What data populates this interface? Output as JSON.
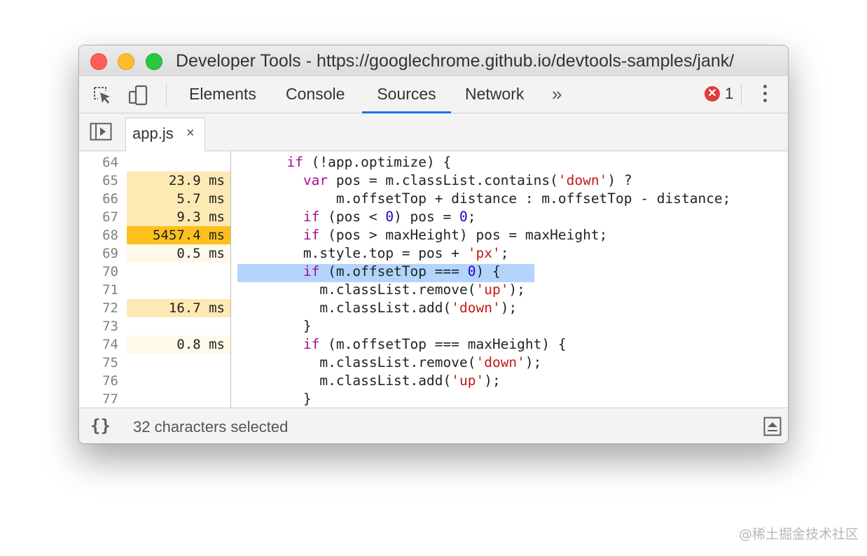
{
  "window": {
    "title": "Developer Tools - https://googlechrome.github.io/devtools-samples/jank/"
  },
  "toolbar": {
    "inspect_icon": "inspect-element-icon",
    "device_icon": "device-toolbar-icon",
    "tabs": [
      {
        "label": "Elements",
        "active": false
      },
      {
        "label": "Console",
        "active": false
      },
      {
        "label": "Sources",
        "active": true
      },
      {
        "label": "Network",
        "active": false
      }
    ],
    "more_tabs": "»",
    "error_count": "1",
    "active_tab_color": "#1a73e8",
    "error_color": "#e03c3c"
  },
  "file_tabs": [
    {
      "name": "app.js",
      "close": "×"
    }
  ],
  "editor": {
    "lines": [
      {
        "num": "64",
        "timing": "",
        "heat": "none"
      },
      {
        "num": "65",
        "timing": "23.9 ms",
        "heat": "light"
      },
      {
        "num": "66",
        "timing": "5.7 ms",
        "heat": "light"
      },
      {
        "num": "67",
        "timing": "9.3 ms",
        "heat": "light"
      },
      {
        "num": "68",
        "timing": "5457.4 ms",
        "heat": "hot"
      },
      {
        "num": "69",
        "timing": "0.5 ms",
        "heat": "faint"
      },
      {
        "num": "70",
        "timing": "",
        "heat": "none"
      },
      {
        "num": "71",
        "timing": "",
        "heat": "none"
      },
      {
        "num": "72",
        "timing": "16.7 ms",
        "heat": "light"
      },
      {
        "num": "73",
        "timing": "",
        "heat": "none"
      },
      {
        "num": "74",
        "timing": "0.8 ms",
        "heat": "faint"
      },
      {
        "num": "75",
        "timing": "",
        "heat": "none"
      },
      {
        "num": "76",
        "timing": "",
        "heat": "none"
      },
      {
        "num": "77",
        "timing": "",
        "heat": "none"
      }
    ],
    "heat_colors": {
      "hot": "#fdc01c",
      "light": "#fde9b3",
      "faint": "#fef9e8",
      "none": "transparent"
    },
    "selection_color": "#b3d4fd",
    "selected_line": "70"
  },
  "statusbar": {
    "pretty_print": "{}",
    "selection_text": "32 characters selected"
  },
  "watermark": "@稀土掘金技术社区"
}
